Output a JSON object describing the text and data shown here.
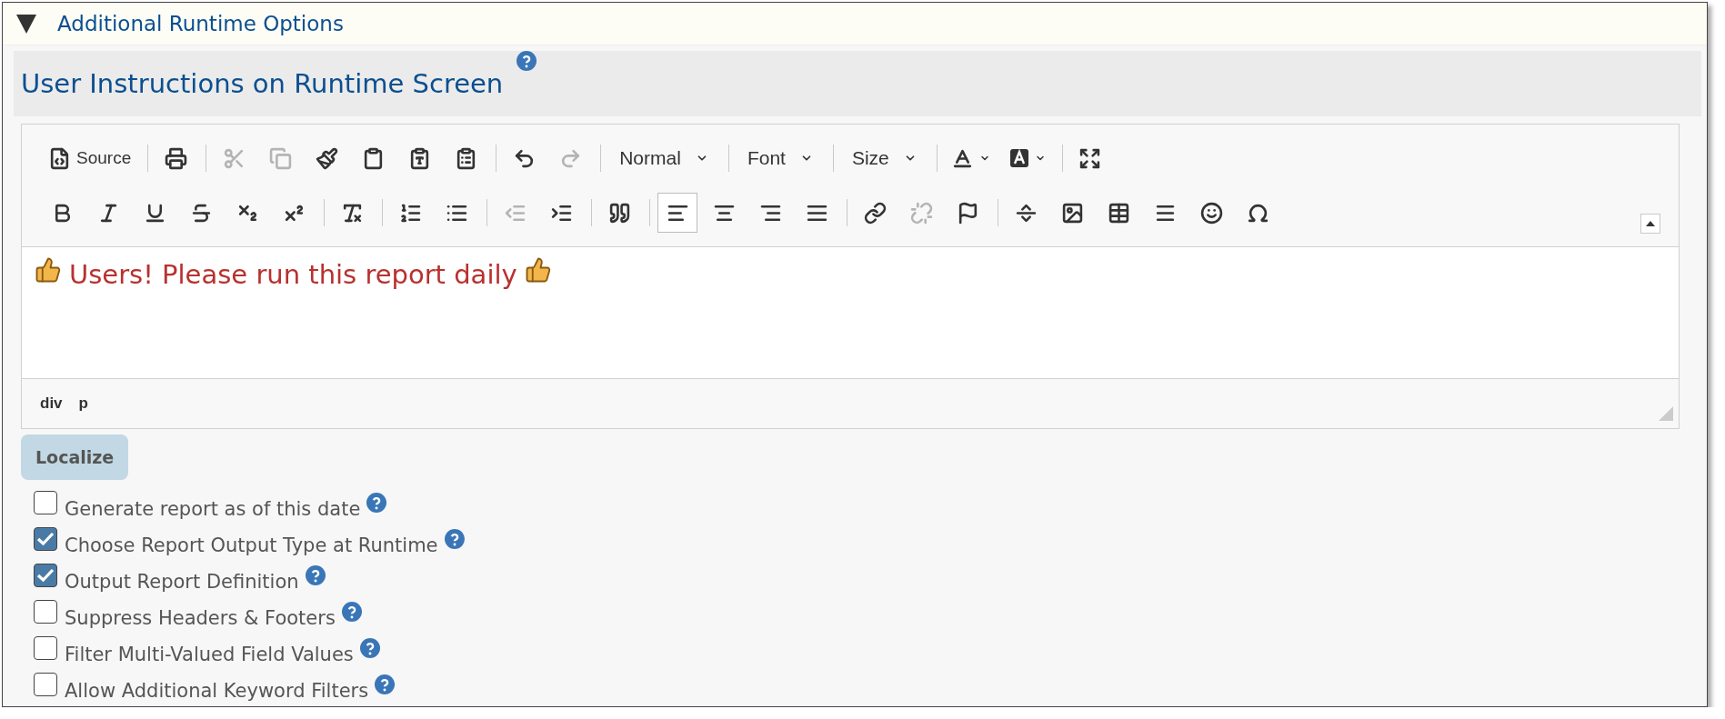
{
  "section": {
    "title": "Additional Runtime Options",
    "expanded": true
  },
  "panel": {
    "title": "User Instructions on Runtime Screen"
  },
  "toolbar": {
    "rows": [
      [
        {
          "kind": "button",
          "label": "Source",
          "disabled": false,
          "selected": false
        },
        {
          "kind": "separator"
        },
        {
          "kind": "button",
          "disabled": false,
          "selected": false
        },
        {
          "kind": "separator"
        },
        {
          "kind": "button",
          "disabled": true,
          "selected": false
        },
        {
          "kind": "button",
          "disabled": true,
          "selected": false
        },
        {
          "kind": "button",
          "disabled": false,
          "selected": false
        },
        {
          "kind": "button",
          "disabled": false,
          "selected": false
        },
        {
          "kind": "button",
          "disabled": false,
          "selected": false
        },
        {
          "kind": "button",
          "disabled": false,
          "selected": false
        },
        {
          "kind": "separator"
        },
        {
          "kind": "button",
          "disabled": false,
          "selected": false
        },
        {
          "kind": "button",
          "disabled": true,
          "selected": false
        },
        {
          "kind": "separator"
        },
        {
          "kind": "dropdown",
          "label": "Normal"
        },
        {
          "kind": "separator"
        },
        {
          "kind": "dropdown",
          "label": "Font"
        },
        {
          "kind": "separator"
        },
        {
          "kind": "dropdown",
          "label": "Size"
        },
        {
          "kind": "separator"
        },
        {
          "kind": "colorbutton",
          "disabled": false,
          "selected": false
        },
        {
          "kind": "colorbutton",
          "disabled": false,
          "selected": false
        },
        {
          "kind": "separator"
        },
        {
          "kind": "button",
          "disabled": false,
          "selected": false
        }
      ],
      [
        {
          "kind": "button",
          "disabled": false,
          "selected": false
        },
        {
          "kind": "button",
          "disabled": false,
          "selected": false
        },
        {
          "kind": "button",
          "disabled": false,
          "selected": false
        },
        {
          "kind": "button",
          "disabled": false,
          "selected": false
        },
        {
          "kind": "button",
          "disabled": false,
          "selected": false
        },
        {
          "kind": "button",
          "disabled": false,
          "selected": false
        },
        {
          "kind": "separator"
        },
        {
          "kind": "button",
          "disabled": false,
          "selected": false
        },
        {
          "kind": "separator"
        },
        {
          "kind": "button",
          "disabled": false,
          "selected": false
        },
        {
          "kind": "button",
          "disabled": false,
          "selected": false
        },
        {
          "kind": "separator"
        },
        {
          "kind": "button",
          "disabled": true,
          "selected": false
        },
        {
          "kind": "button",
          "disabled": false,
          "selected": false
        },
        {
          "kind": "separator"
        },
        {
          "kind": "button",
          "disabled": false,
          "selected": false
        },
        {
          "kind": "separator"
        },
        {
          "kind": "button",
          "disabled": false,
          "selected": true
        },
        {
          "kind": "button",
          "disabled": false,
          "selected": false
        },
        {
          "kind": "button",
          "disabled": false,
          "selected": false
        },
        {
          "kind": "button",
          "disabled": false,
          "selected": false
        },
        {
          "kind": "separator"
        },
        {
          "kind": "button",
          "disabled": false,
          "selected": false
        },
        {
          "kind": "button",
          "disabled": true,
          "selected": false
        },
        {
          "kind": "button",
          "disabled": false,
          "selected": false
        },
        {
          "kind": "separator"
        },
        {
          "kind": "button",
          "disabled": false,
          "selected": false
        },
        {
          "kind": "button",
          "disabled": false,
          "selected": false
        },
        {
          "kind": "button",
          "disabled": false,
          "selected": false
        },
        {
          "kind": "button",
          "disabled": false,
          "selected": false
        },
        {
          "kind": "button",
          "disabled": false,
          "selected": false
        },
        {
          "kind": "button",
          "disabled": false,
          "selected": false
        }
      ]
    ]
  },
  "editor": {
    "content": "Users! Please run this report daily",
    "path": [
      "div",
      "p"
    ]
  },
  "localize_button": "Localize",
  "options": [
    {
      "label": "Generate report as of this date",
      "checked": false
    },
    {
      "label": "Choose Report Output Type at Runtime",
      "checked": true
    },
    {
      "label": "Output Report Definition",
      "checked": true
    },
    {
      "label": "Suppress Headers & Footers",
      "checked": false
    },
    {
      "label": "Filter Multi-Valued Field Values",
      "checked": false
    },
    {
      "label": "Allow Additional Keyword Filters",
      "checked": false
    }
  ]
}
